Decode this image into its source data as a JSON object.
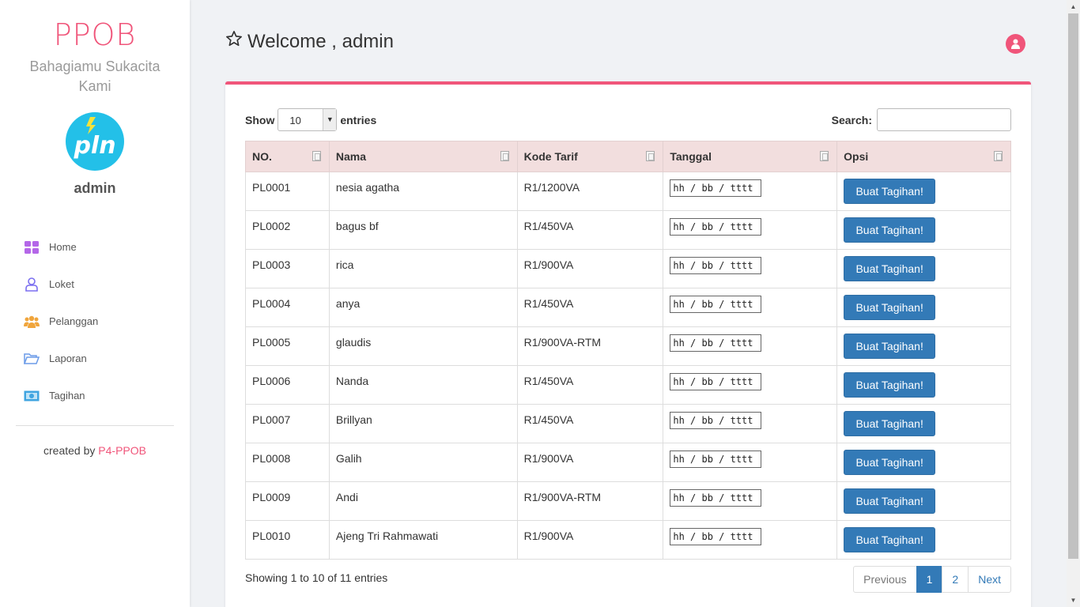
{
  "sidebar": {
    "brand": "PPOB",
    "tagline": "Bahagiamu Sukacita Kami",
    "logo_text": "pln",
    "username": "admin",
    "menu": [
      {
        "label": "Home",
        "icon": "grid-icon",
        "color": "#b467e8"
      },
      {
        "label": "Loket",
        "icon": "user-icon",
        "color": "#7b6ff0"
      },
      {
        "label": "Pelanggan",
        "icon": "users-icon",
        "color": "#f0a53c"
      },
      {
        "label": "Laporan",
        "icon": "folder-icon",
        "color": "#6b9be8"
      },
      {
        "label": "Tagihan",
        "icon": "money-icon",
        "color": "#3fa4e0"
      }
    ],
    "credit_prefix": "created by",
    "credit_link": "P4-PPOB"
  },
  "header": {
    "title": "Welcome , admin",
    "accent": "#f0557a"
  },
  "table_controls": {
    "show_label": "Show",
    "entries_value": "10",
    "entries_label": "entries",
    "search_label": "Search:",
    "search_value": ""
  },
  "table": {
    "columns": [
      "NO.",
      "Nama",
      "Kode Tarif",
      "Tanggal",
      "Opsi"
    ],
    "date_placeholder": "hh / bb / tttt",
    "button_label": "Buat Tagihan!",
    "rows": [
      {
        "no": "PL0001",
        "nama": "nesia agatha",
        "tarif": "R1/1200VA"
      },
      {
        "no": "PL0002",
        "nama": "bagus bf",
        "tarif": "R1/450VA"
      },
      {
        "no": "PL0003",
        "nama": "rica",
        "tarif": "R1/900VA"
      },
      {
        "no": "PL0004",
        "nama": "anya",
        "tarif": "R1/450VA"
      },
      {
        "no": "PL0005",
        "nama": "glaudis",
        "tarif": "R1/900VA-RTM"
      },
      {
        "no": "PL0006",
        "nama": "Nanda",
        "tarif": "R1/450VA"
      },
      {
        "no": "PL0007",
        "nama": "Brillyan",
        "tarif": "R1/450VA"
      },
      {
        "no": "PL0008",
        "nama": "Galih",
        "tarif": "R1/900VA"
      },
      {
        "no": "PL0009",
        "nama": "Andi",
        "tarif": "R1/900VA-RTM"
      },
      {
        "no": "PL0010",
        "nama": "Ajeng Tri Rahmawati",
        "tarif": "R1/900VA"
      }
    ]
  },
  "footer": {
    "info": "Showing 1 to 10 of 11 entries",
    "pagination": {
      "previous": "Previous",
      "pages": [
        "1",
        "2"
      ],
      "next": "Next",
      "active": "1"
    }
  }
}
